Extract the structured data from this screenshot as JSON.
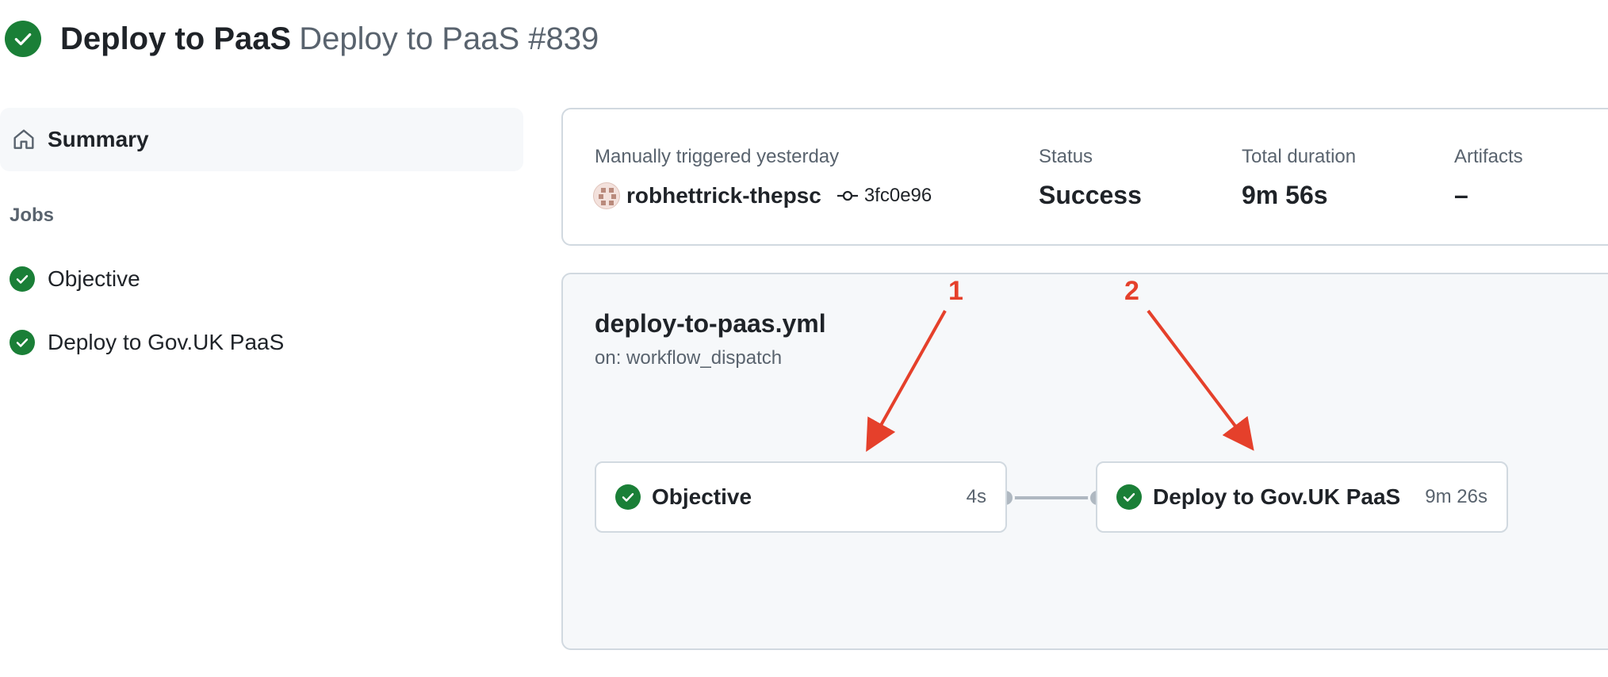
{
  "header": {
    "workflow_name": "Deploy to PaaS",
    "run_title": "Deploy to PaaS #839",
    "status_icon": "check-circle-fill-icon"
  },
  "sidebar": {
    "summary_label": "Summary",
    "summary_icon": "home-icon",
    "jobs_heading": "Jobs",
    "jobs": [
      {
        "label": "Objective",
        "icon": "check-circle-fill-icon"
      },
      {
        "label": "Deploy to Gov.UK PaaS",
        "icon": "check-circle-fill-icon"
      }
    ]
  },
  "summary": {
    "trigger_label": "Manually triggered yesterday",
    "actor": "robhettrick-thepsc",
    "commit_sha": "3fc0e96",
    "status_label": "Status",
    "status_value": "Success",
    "duration_label": "Total duration",
    "duration_value": "9m 56s",
    "artifacts_label": "Artifacts",
    "artifacts_value": "–"
  },
  "graph": {
    "workflow_file": "deploy-to-paas.yml",
    "trigger": "on: workflow_dispatch",
    "jobs": [
      {
        "name": "Objective",
        "duration": "4s"
      },
      {
        "name": "Deploy to Gov.UK PaaS",
        "duration": "9m 26s"
      }
    ]
  },
  "annotations": {
    "color": "#e5402b",
    "labels": [
      "1",
      "2"
    ]
  },
  "colors": {
    "success": "#1a7f37",
    "muted_text": "#59636e",
    "border": "#d1d9e0",
    "panel_bg": "#f6f8fa"
  }
}
